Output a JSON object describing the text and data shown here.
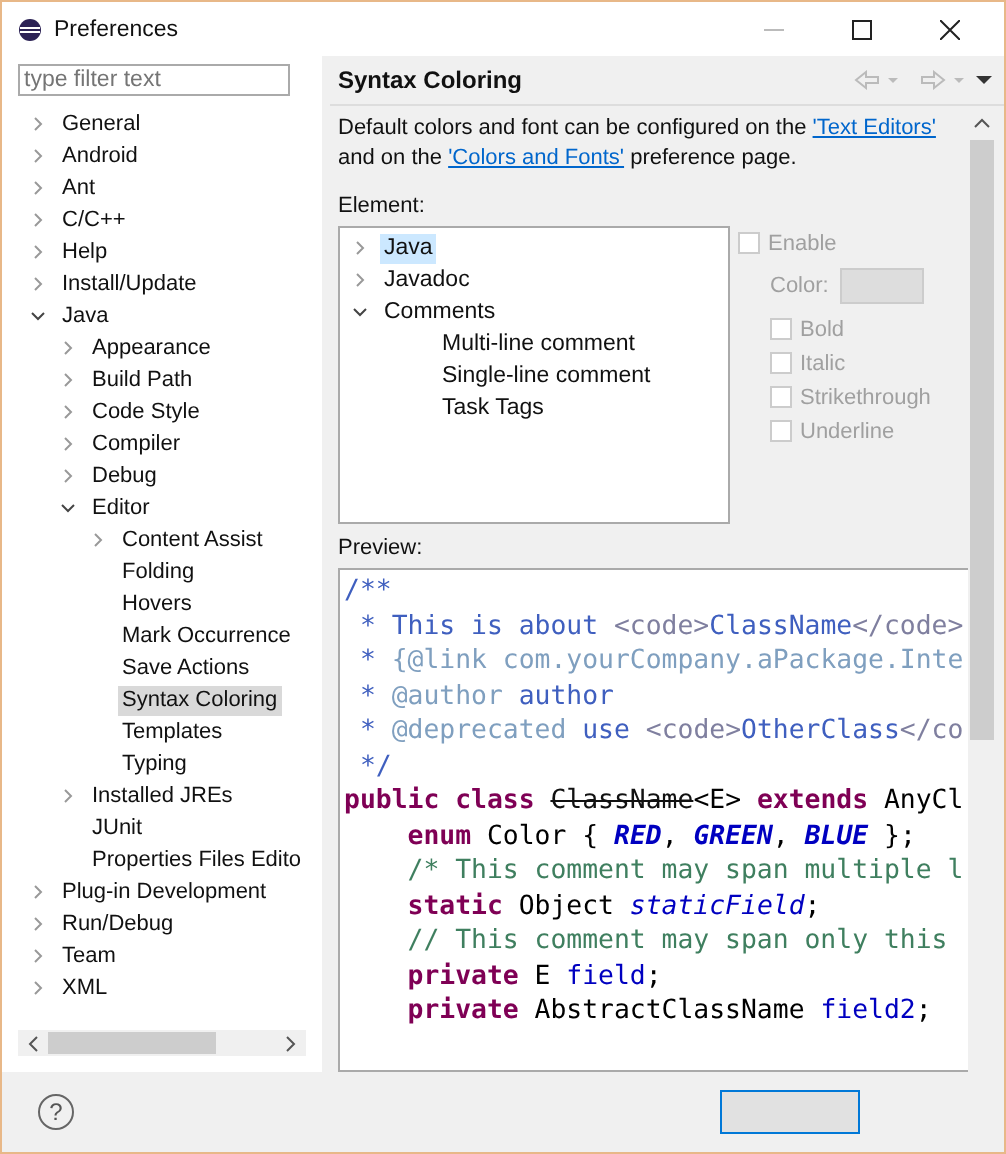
{
  "window": {
    "title": "Preferences"
  },
  "filter": {
    "placeholder": "type filter text"
  },
  "sidebar": {
    "items": [
      {
        "label": "General",
        "kind": "branch",
        "expanded": false,
        "selected": false
      },
      {
        "label": "Android",
        "kind": "branch",
        "expanded": false,
        "selected": false
      },
      {
        "label": "Ant",
        "kind": "branch",
        "expanded": false,
        "selected": false
      },
      {
        "label": "C/C++",
        "kind": "branch",
        "expanded": false,
        "selected": false
      },
      {
        "label": "Help",
        "kind": "branch",
        "expanded": false,
        "selected": false
      },
      {
        "label": "Install/Update",
        "kind": "branch",
        "expanded": false,
        "selected": false
      },
      {
        "label": "Java",
        "kind": "branch",
        "expanded": true,
        "selected": false,
        "children": [
          {
            "label": "Appearance",
            "kind": "branch",
            "expanded": false,
            "selected": false
          },
          {
            "label": "Build Path",
            "kind": "branch",
            "expanded": false,
            "selected": false
          },
          {
            "label": "Code Style",
            "kind": "branch",
            "expanded": false,
            "selected": false
          },
          {
            "label": "Compiler",
            "kind": "branch",
            "expanded": false,
            "selected": false
          },
          {
            "label": "Debug",
            "kind": "branch",
            "expanded": false,
            "selected": false
          },
          {
            "label": "Editor",
            "kind": "branch",
            "expanded": true,
            "selected": false,
            "children": [
              {
                "label": "Content Assist",
                "kind": "branch",
                "expanded": false,
                "selected": false
              },
              {
                "label": "Folding",
                "kind": "leaf",
                "selected": false
              },
              {
                "label": "Hovers",
                "kind": "leaf",
                "selected": false
              },
              {
                "label": "Mark Occurrence",
                "kind": "leaf",
                "selected": false
              },
              {
                "label": "Save Actions",
                "kind": "leaf",
                "selected": false
              },
              {
                "label": "Syntax Coloring",
                "kind": "leaf",
                "selected": true
              },
              {
                "label": "Templates",
                "kind": "leaf",
                "selected": false
              },
              {
                "label": "Typing",
                "kind": "leaf",
                "selected": false
              }
            ]
          },
          {
            "label": "Installed JREs",
            "kind": "branch",
            "expanded": false,
            "selected": false
          },
          {
            "label": "JUnit",
            "kind": "leaf",
            "selected": false
          },
          {
            "label": "Properties Files Edito",
            "kind": "leaf",
            "selected": false
          }
        ]
      },
      {
        "label": "Plug-in Development",
        "kind": "branch",
        "expanded": false,
        "selected": false
      },
      {
        "label": "Run/Debug",
        "kind": "branch",
        "expanded": false,
        "selected": false
      },
      {
        "label": "Team",
        "kind": "branch",
        "expanded": false,
        "selected": false
      },
      {
        "label": "XML",
        "kind": "branch",
        "expanded": false,
        "selected": false
      }
    ]
  },
  "page": {
    "title": "Syntax Coloring",
    "description": [
      "Default colors and font can be configured on the ",
      "'Text Editors'",
      " and on the ",
      "'Colors and Fonts'",
      " preference page."
    ],
    "element_label": "Element:",
    "elements": [
      {
        "label": "Java",
        "kind": "branch",
        "expanded": false,
        "selected": true
      },
      {
        "label": "Javadoc",
        "kind": "branch",
        "expanded": false,
        "selected": false
      },
      {
        "label": "Comments",
        "kind": "branch",
        "expanded": true,
        "selected": false,
        "children": [
          {
            "label": "Multi-line comment",
            "kind": "leaf",
            "selected": false
          },
          {
            "label": "Single-line comment",
            "kind": "leaf",
            "selected": false
          },
          {
            "label": "Task Tags",
            "kind": "leaf",
            "selected": false
          }
        ]
      }
    ],
    "enable": {
      "label": "Enable",
      "checked": false,
      "disabled": true
    },
    "color_label": "Color:",
    "styles": [
      {
        "label": "Bold",
        "checked": false
      },
      {
        "label": "Italic",
        "checked": false
      },
      {
        "label": "Strikethrough",
        "checked": false
      },
      {
        "label": "Underline",
        "checked": false
      }
    ],
    "preview_label": "Preview:",
    "preview_lines": [
      [
        {
          "t": "/**",
          "kind": "javadoc"
        }
      ],
      [
        {
          "t": " * This is about ",
          "kind": "javadoc"
        },
        {
          "t": "<code>",
          "kind": "html"
        },
        {
          "t": "ClassName",
          "kind": "javadoc"
        },
        {
          "t": "</code>",
          "kind": "html"
        }
      ],
      [
        {
          "t": " * ",
          "kind": "javadoc"
        },
        {
          "t": "{@link com.yourCompany.aPackage.Inte",
          "kind": "tag"
        }
      ],
      [
        {
          "t": " * ",
          "kind": "javadoc"
        },
        {
          "t": "@author",
          "kind": "tag"
        },
        {
          "t": " author",
          "kind": "javadoc"
        }
      ],
      [
        {
          "t": " * ",
          "kind": "javadoc"
        },
        {
          "t": "@deprecated",
          "kind": "tag"
        },
        {
          "t": " use ",
          "kind": "javadoc"
        },
        {
          "t": "<code>",
          "kind": "html"
        },
        {
          "t": "OtherClass",
          "kind": "javadoc"
        },
        {
          "t": "</co",
          "kind": "html"
        }
      ],
      [
        {
          "t": " */",
          "kind": "javadoc"
        }
      ],
      [
        {
          "t": "public class ",
          "kind": "keyword"
        },
        {
          "t": "ClassName",
          "kind": "strike"
        },
        {
          "t": "<E> ",
          "kind": "plain"
        },
        {
          "t": "extends ",
          "kind": "keyword"
        },
        {
          "t": "AnyCl",
          "kind": "plain"
        }
      ],
      [
        {
          "t": "    enum ",
          "kind": "keyword"
        },
        {
          "t": "Color { ",
          "kind": "plain"
        },
        {
          "t": "RED",
          "kind": "enum"
        },
        {
          "t": ", ",
          "kind": "plain"
        },
        {
          "t": "GREEN",
          "kind": "enum"
        },
        {
          "t": ", ",
          "kind": "plain"
        },
        {
          "t": "BLUE",
          "kind": "enum"
        },
        {
          "t": " };",
          "kind": "plain"
        }
      ],
      [
        {
          "t": "    /* This comment may span multiple l",
          "kind": "comment"
        }
      ],
      [
        {
          "t": "    static ",
          "kind": "keyword"
        },
        {
          "t": "Object ",
          "kind": "plain"
        },
        {
          "t": "staticField",
          "kind": "static"
        },
        {
          "t": ";",
          "kind": "plain"
        }
      ],
      [
        {
          "t": "    // This comment may span only this",
          "kind": "comment"
        }
      ],
      [
        {
          "t": "    private ",
          "kind": "keyword"
        },
        {
          "t": "E ",
          "kind": "plain"
        },
        {
          "t": "field",
          "kind": "field"
        },
        {
          "t": ";",
          "kind": "plain"
        }
      ],
      [
        {
          "t": "    private ",
          "kind": "keyword"
        },
        {
          "t": "AbstractClassName ",
          "kind": "plain"
        },
        {
          "t": "field2",
          "kind": "field"
        },
        {
          "t": ";",
          "kind": "plain"
        }
      ]
    ]
  },
  "footer": {
    "help": "?"
  }
}
